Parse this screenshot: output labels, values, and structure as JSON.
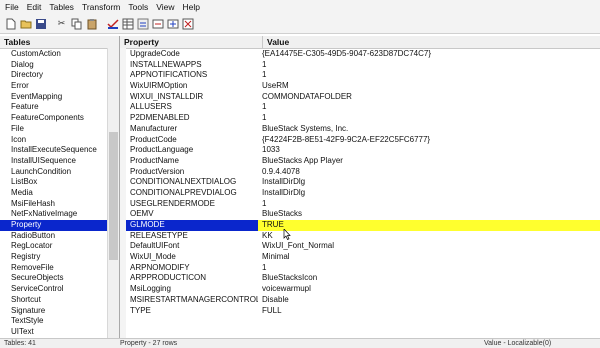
{
  "menu": [
    "File",
    "Edit",
    "Tables",
    "Transform",
    "Tools",
    "View",
    "Help"
  ],
  "toolbar": [
    "new-icon",
    "open-icon",
    "save-icon",
    "cut-icon",
    "copy-icon",
    "paste-icon",
    "validate-icon",
    "table-icon",
    "find-icon",
    "import-icon",
    "export-icon",
    "properties-icon"
  ],
  "tables": {
    "header": "Tables",
    "items": [
      "CustomAction",
      "Dialog",
      "Directory",
      "Error",
      "EventMapping",
      "Feature",
      "FeatureComponents",
      "File",
      "Icon",
      "InstallExecuteSequence",
      "InstallUISequence",
      "LaunchCondition",
      "ListBox",
      "Media",
      "MsiFileHash",
      "NetFxNativeImage",
      "Property",
      "RadioButton",
      "RegLocator",
      "Registry",
      "RemoveFile",
      "SecureObjects",
      "ServiceControl",
      "Shortcut",
      "Signature",
      "TextStyle",
      "UIText"
    ],
    "selected": "Property"
  },
  "grid": {
    "col_property": "Property",
    "col_value": "Value",
    "rows": [
      {
        "p": "UpgradeCode",
        "v": "{EA14475E-C305-49D5-9047-623D87DC74C7}"
      },
      {
        "p": "INSTALLNEWAPPS",
        "v": "1"
      },
      {
        "p": "APPNOTIFICATIONS",
        "v": "1"
      },
      {
        "p": "WixUIRMOption",
        "v": "UseRM"
      },
      {
        "p": "WIXUI_INSTALLDIR",
        "v": "COMMONDATAFOLDER"
      },
      {
        "p": "ALLUSERS",
        "v": "1"
      },
      {
        "p": "P2DMENABLED",
        "v": "1"
      },
      {
        "p": "Manufacturer",
        "v": "BlueStack Systems, Inc."
      },
      {
        "p": "ProductCode",
        "v": "{F4224F2B-8E51-42F9-9C2A-EF22C5FC6777}"
      },
      {
        "p": "ProductLanguage",
        "v": "1033"
      },
      {
        "p": "ProductName",
        "v": "BlueStacks App Player"
      },
      {
        "p": "ProductVersion",
        "v": "0.9.4.4078"
      },
      {
        "p": "CONDITIONALNEXTDIALOG",
        "v": "InstallDirDlg"
      },
      {
        "p": "CONDITIONALPREVDIALOG",
        "v": "InstallDirDlg"
      },
      {
        "p": "USEGLRENDERMODE",
        "v": "1"
      },
      {
        "p": "OEMV",
        "v": "BlueStacks"
      },
      {
        "p": "GLMODE",
        "v": "TRUE"
      },
      {
        "p": "RELEASETYPE",
        "v": "KK"
      },
      {
        "p": "DefaultUIFont",
        "v": "WixUI_Font_Normal"
      },
      {
        "p": "WixUI_Mode",
        "v": "Minimal"
      },
      {
        "p": "ARPNOMODIFY",
        "v": "1"
      },
      {
        "p": "ARPPRODUCTICON",
        "v": "BlueStacksIcon"
      },
      {
        "p": "MsiLogging",
        "v": "voicewarmupl"
      },
      {
        "p": "MSIRESTARTMANAGERCONTROL",
        "v": "Disable"
      },
      {
        "p": "TYPE",
        "v": "FULL"
      },
      {
        "p": "",
        "v": ""
      }
    ],
    "selected_property": "GLMODE"
  },
  "status": {
    "left": "Tables: 41",
    "mid": "Property - 27 rows",
    "right": "Value - Localizable(0)"
  },
  "colors": {
    "selection_blue": "#0a26cc",
    "highlight_yellow": "#ffff2e"
  }
}
